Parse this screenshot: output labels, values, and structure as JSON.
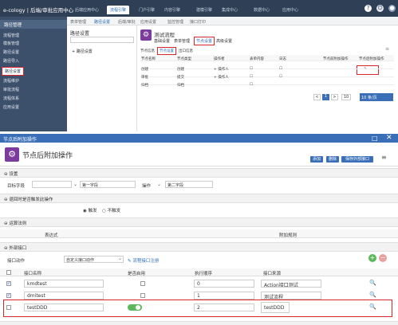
{
  "app": {
    "title": "e-cology | 后端/审批应用中心"
  },
  "topnav": {
    "tabs": [
      "后端应用中心",
      "流程引擎",
      "门户引擎",
      "内容引擎",
      "建模引擎",
      "集成中心",
      "数据中心",
      "应用中心"
    ],
    "active_index": 1
  },
  "subnav": {
    "tabs": [
      "表单管理",
      "路径设置",
      "后端/审批",
      "应用设置",
      "监控管理",
      "接口打印"
    ]
  },
  "sidebar": {
    "header": "路径管理",
    "items": [
      "流程管理",
      "模板管理",
      "路径设置",
      "路径导入",
      "路径设置",
      "流程维护",
      "审批流程",
      "流程体系",
      "应用设置"
    ],
    "highlighted_index": 4
  },
  "tree": {
    "title": "路径设置",
    "node": "路径设置"
  },
  "workflow": {
    "name": "测试流程",
    "tabs": [
      "基础设置",
      "表单管理",
      "节点设置",
      "高级设置"
    ],
    "active_tab": "节点设置",
    "subtabs": [
      "节点信息",
      "节点设置",
      "出口信息"
    ],
    "active_subtab": "节点设置"
  },
  "node_table": {
    "headers": [
      "节点名称",
      "节点类型",
      "操作者",
      "表单内容",
      "日志",
      "节点前附加操作",
      "节点后附加操作",
      "节点前附加操作"
    ],
    "rows": [
      [
        "创建",
        "创建",
        "+ 操作人",
        "☐",
        "☐",
        "",
        "",
        ""
      ],
      [
        "审批",
        "提交",
        "+ 操作人",
        "☐",
        "☐",
        "",
        "",
        ""
      ],
      [
        "归档",
        "归档",
        "",
        "☐",
        "",
        "",
        "",
        ""
      ]
    ]
  },
  "pager": {
    "prev": "<",
    "page": "1",
    "next": ">",
    "page_size": "10",
    "per_page": "10 条/页",
    "goto": "到第"
  },
  "modal": {
    "window_title": "节点后附加操作",
    "title": "节点后附加操作",
    "buttons": {
      "add": "添加",
      "delete": "删除",
      "save": "保存外部接口"
    }
  },
  "sections": {
    "settings": "设置",
    "return_action": "退回时是否触发此操作",
    "calc_rules": "运算法则",
    "external": "外部接口"
  },
  "settings": {
    "target_label": "目标字段",
    "target_value": "",
    "field1": "第一字段",
    "op": "操作",
    "field2": "第二字段"
  },
  "return_opts": {
    "trigger": "触发",
    "no_trigger": "不触发",
    "selected": "trigger"
  },
  "calc_table": {
    "col1": "表达式",
    "col2": "附加规则"
  },
  "ext": {
    "label": "接口动作",
    "select": "自定义接口动作",
    "link": "流程接口注册"
  },
  "iface_table": {
    "headers": [
      "接口名称",
      "是否启用",
      "执行顺序",
      "接口来源"
    ],
    "rows": [
      {
        "checked": true,
        "name": "kmdtest",
        "enabled": false,
        "order": "0",
        "source": "Action接口测试"
      },
      {
        "checked": true,
        "name": "dmitest",
        "enabled": false,
        "order": "1",
        "source": "测试流程"
      },
      {
        "checked": false,
        "name": "testDDD",
        "enabled": true,
        "order": "2",
        "source": "testDDD"
      }
    ]
  },
  "colors": {
    "topbar": "#2f3f56",
    "sidebar": "#3c4f6b",
    "accent": "#3a6fb8",
    "highlight": "#d9262c",
    "purple": "#7c3c9e",
    "toggle_on": "#5cb85c"
  }
}
